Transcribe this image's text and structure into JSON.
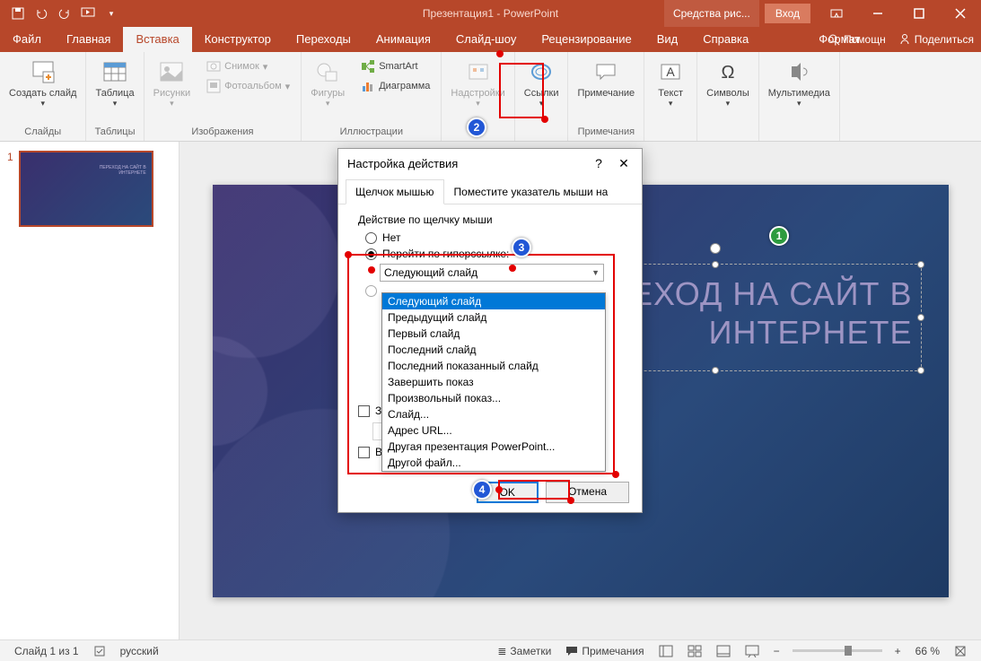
{
  "title": "Презентация1 - PowerPoint",
  "context_tab": "Средства рис...",
  "login": "Вход",
  "tabs": {
    "file": "Файл",
    "home": "Главная",
    "insert": "Вставка",
    "design": "Конструктор",
    "transitions": "Переходы",
    "animations": "Анимация",
    "slideshow": "Слайд-шоу",
    "review": "Рецензирование",
    "view": "Вид",
    "help": "Справка",
    "format": "Формат",
    "tell": "Помощн",
    "share": "Поделиться"
  },
  "ribbon": {
    "new_slide": "Создать слайд",
    "slides": "Слайды",
    "table": "Таблица",
    "tables": "Таблицы",
    "pictures": "Рисунки",
    "screenshot": "Снимок",
    "photoalbum": "Фотоальбом",
    "images": "Изображения",
    "shapes": "Фигуры",
    "smartart": "SmartArt",
    "chart": "Диаграмма",
    "illustrations": "Иллюстрации",
    "addins": "Надстройки",
    "links": "Ссылки",
    "comment": "Примечание",
    "comments": "Примечания",
    "text": "Текст",
    "symbols": "Символы",
    "media": "Мультимедиа"
  },
  "thumb_num": "1",
  "slide_title_l1": "ЕХОД НА САЙТ В",
  "slide_title_l2": "ИНТЕРНЕТЕ",
  "thumb_title": "ПЕРЕХОД НА САЙТ В\nИНТЕРНЕТЕ",
  "dialog": {
    "title": "Настройка действия",
    "tab1": "Щелчок мышью",
    "tab2": "Поместите указатель мыши на",
    "group": "Действие по щелчку мыши",
    "r_none": "Нет",
    "r_hyperlink": "Перейти по гиперссылке:",
    "combo_value": "Следующий слайд",
    "options": [
      "Следующий слайд",
      "Предыдущий слайд",
      "Первый слайд",
      "Последний слайд",
      "Последний показанный слайд",
      "Завершить показ",
      "Произвольный показ...",
      "Слайд...",
      "Адрес URL...",
      "Другая презентация PowerPoint...",
      "Другой файл..."
    ],
    "chk_sound": "З",
    "chk_highlight": "В",
    "ok": "OK",
    "cancel": "Отмена"
  },
  "status": {
    "slide": "Слайд 1 из 1",
    "lang": "русский",
    "notes": "Заметки",
    "comments": "Примечания",
    "zoom": "66 %"
  },
  "anno": {
    "a1": "1",
    "a2": "2",
    "a3": "3",
    "a4": "4"
  }
}
